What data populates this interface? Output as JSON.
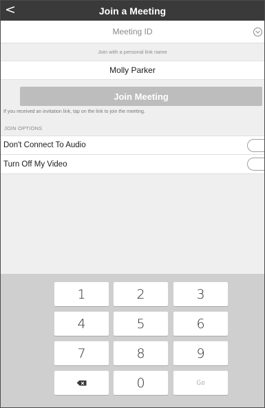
{
  "header": {
    "back_glyph": "<",
    "title": "Join a Meeting"
  },
  "meeting_id": {
    "placeholder": "Meeting ID",
    "value": ""
  },
  "personal_link": {
    "label": "Join with a personal link name"
  },
  "name": {
    "value": "Molly Parker"
  },
  "join_button": {
    "label": "Join Meeting",
    "enabled": false
  },
  "invitation_hint": "If you received an invitation link, tap on the link to join the meeting.",
  "join_options": {
    "header": "JOIN OPTIONS",
    "items": [
      {
        "label": "Don't Connect To Audio",
        "on": false
      },
      {
        "label": "Turn Off My Video",
        "on": false
      }
    ]
  },
  "keypad": {
    "keys": [
      "1",
      "2",
      "3",
      "4",
      "5",
      "6",
      "7",
      "8",
      "9",
      "backspace-icon",
      "0",
      "Go"
    ],
    "go_label": "Go",
    "zero_label": "0"
  },
  "colors": {
    "header_bg": "#3a3a3a",
    "join_disabled": "#bdbdbd",
    "keypad_bg": "#cfcfcf"
  }
}
